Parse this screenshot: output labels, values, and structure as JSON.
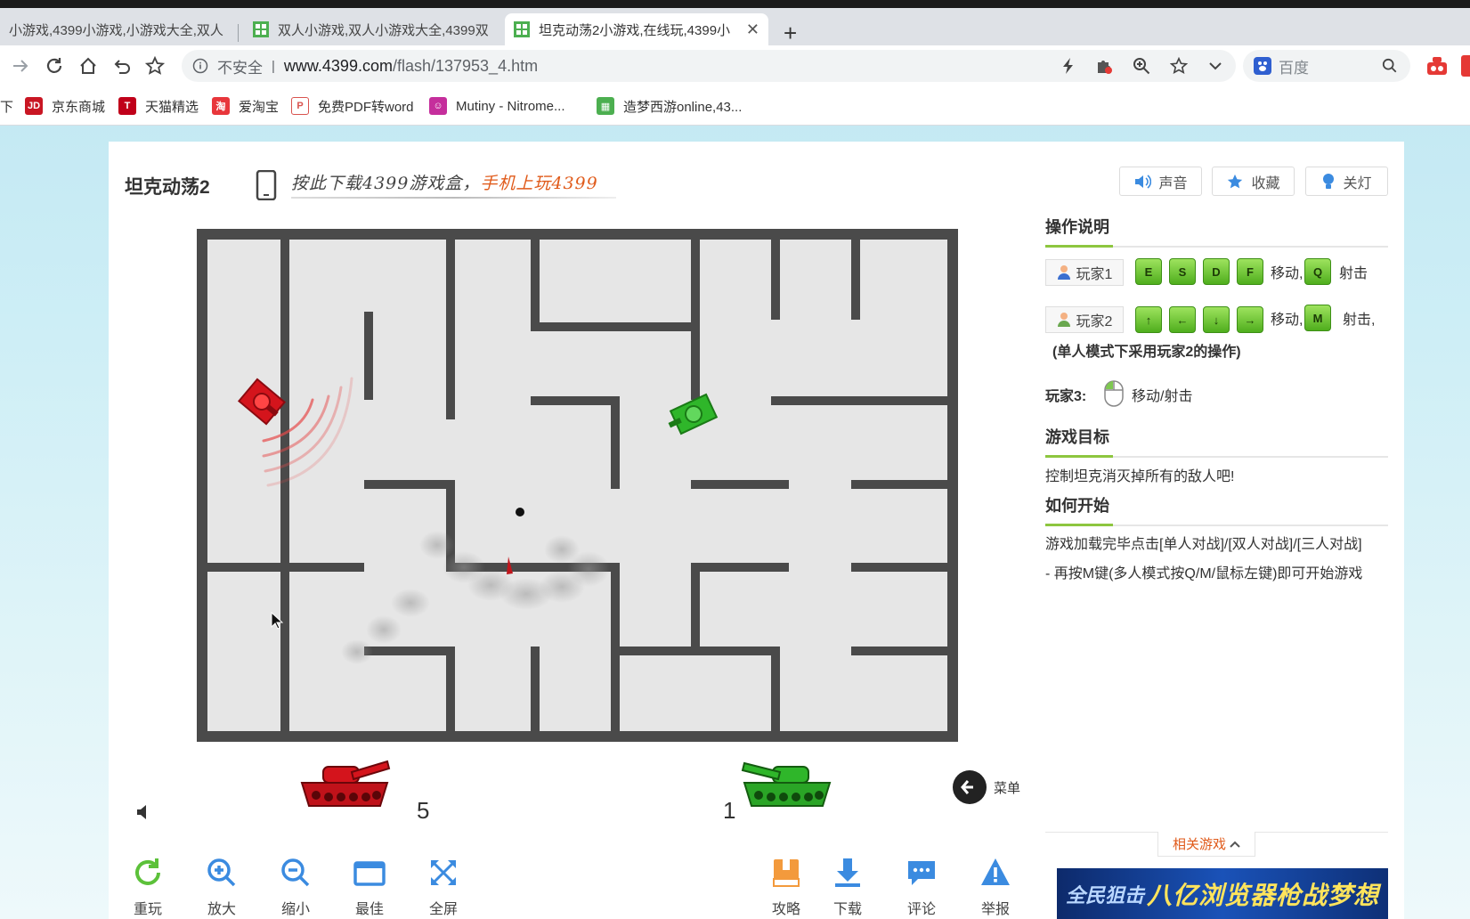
{
  "browser": {
    "tabs": [
      {
        "title": "小游戏,4399小游戏,小游戏大全,双人",
        "active": false
      },
      {
        "title": "双人小游戏,双人小游戏大全,4399双",
        "active": false
      },
      {
        "title": "坦克动荡2小游戏,在线玩,4399小",
        "active": true
      }
    ],
    "new_tab": "+",
    "close_glyph": "✕",
    "address": {
      "security_label": "不安全",
      "separator": "|",
      "url_host": "www.4399.com",
      "url_path": "/flash/137953_4.htm"
    },
    "search": {
      "engine": "百度"
    },
    "bookmarks": [
      {
        "label": "下",
        "icon": "folder-icon"
      },
      {
        "label": "京东商城",
        "badge": "JD",
        "color": "#c91623"
      },
      {
        "label": "天猫精选",
        "badge": "T",
        "color": "#c0001a"
      },
      {
        "label": "爱淘宝",
        "badge": "淘",
        "color": "#e8363b"
      },
      {
        "label": "免费PDF转word",
        "badge": "P",
        "color": "#d9534f"
      },
      {
        "label": "Mutiny - Nitrome...",
        "badge": "☺",
        "color": "#c52e9c"
      },
      {
        "label": "造梦西游online,43...",
        "badge": "▦",
        "color": "#4caf50"
      }
    ]
  },
  "page": {
    "game_title": "坦克动荡2",
    "promo_text": "按此下载4399游戏盒，",
    "promo_accent": "手机上玩4399",
    "buttons": {
      "sound": "声音",
      "favorite": "收藏",
      "lights": "关灯"
    },
    "scores": {
      "red": "5",
      "green": "1"
    },
    "menu_label": "菜单",
    "controls": [
      {
        "label": "重玩",
        "icon": "replay-icon"
      },
      {
        "label": "放大",
        "icon": "zoom-in-icon"
      },
      {
        "label": "缩小",
        "icon": "zoom-out-icon"
      },
      {
        "label": "最佳",
        "icon": "best-fit-icon"
      },
      {
        "label": "全屏",
        "icon": "fullscreen-icon"
      },
      {
        "label": "攻略",
        "icon": "guide-icon"
      },
      {
        "label": "下载",
        "icon": "download-icon"
      },
      {
        "label": "评论",
        "icon": "comment-icon"
      },
      {
        "label": "举报",
        "icon": "report-icon"
      }
    ]
  },
  "sidebar": {
    "instructions_title": "操作说明",
    "player1": {
      "label": "玩家1",
      "keys": [
        "E",
        "S",
        "D",
        "F"
      ],
      "move": "移动,",
      "fire_key": "Q",
      "fire": "射击"
    },
    "player2": {
      "label": "玩家2",
      "keys": [
        "↑",
        "←",
        "↓",
        "→"
      ],
      "move": "移动,",
      "fire_key": "M",
      "fire": "射击,"
    },
    "single_note": "(单人模式下采用玩家2的操作)",
    "player3": {
      "label": "玩家3:",
      "action": "移动/射击"
    },
    "goal_title": "游戏目标",
    "goal_text": "控制坦克消灭掉所有的敌人吧!",
    "start_title": "如何开始",
    "start_line1": "游戏加载完毕点击[单人对战]/[双人对战]/[三人对战]",
    "start_line2": "- 再按M键(多人模式按Q/M/鼠标左键)即可开始游戏",
    "related": "相关游戏",
    "banner_left": "全民狙击",
    "banner_right": "八亿浏览器枪战梦想"
  },
  "colors": {
    "accent_green": "#8dc63f",
    "accent_orange": "#e05a1a",
    "maze_wall": "#4a4a4a",
    "maze_floor": "#e6e6e6",
    "tank_red": "#d4141c",
    "tank_green": "#2fb62a"
  }
}
